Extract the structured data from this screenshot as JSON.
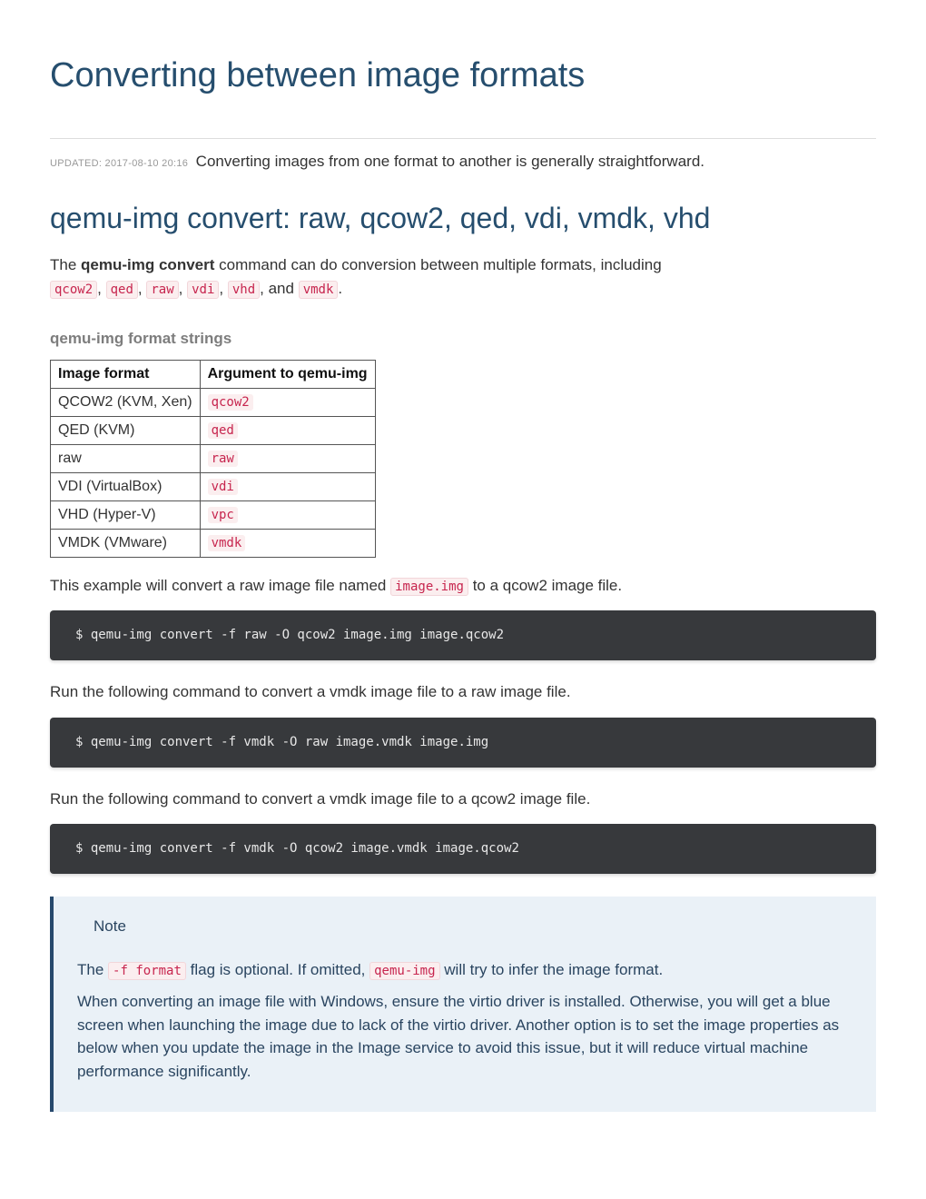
{
  "title": "Converting between image formats",
  "updated_label": "UPDATED: 2017-08-10 20:16",
  "intro": "Converting images from one format to another is generally straightforward.",
  "section_heading": "qemu-img convert: raw, qcow2, qed, vdi, vmdk, vhd",
  "desc_pre": "The ",
  "desc_cmd": "qemu-img convert",
  "desc_mid": " command can do conversion between multiple formats, including ",
  "desc_sep": ", ",
  "desc_and": ", and ",
  "desc_period": ".",
  "format_codes": [
    "qcow2",
    "qed",
    "raw",
    "vdi",
    "vhd",
    "vmdk"
  ],
  "table_title": "qemu-img format strings",
  "table_headers": [
    "Image format",
    "Argument to qemu-img"
  ],
  "table_rows": [
    {
      "format": "QCOW2 (KVM, Xen)",
      "arg": "qcow2"
    },
    {
      "format": "QED (KVM)",
      "arg": "qed"
    },
    {
      "format": "raw",
      "arg": "raw"
    },
    {
      "format": "VDI (VirtualBox)",
      "arg": "vdi"
    },
    {
      "format": "VHD (Hyper-V)",
      "arg": "vpc"
    },
    {
      "format": "VMDK (VMware)",
      "arg": "vmdk"
    }
  ],
  "example_intro_pre": "This example will convert a raw image file named ",
  "example_intro_code": "image.img",
  "example_intro_post": " to a qcow2 image file.",
  "prompt": "$ ",
  "cmd1": "qemu-img convert -f raw -O qcow2 image.img image.qcow2",
  "para2": "Run the following command to convert a vmdk image file to a raw image file.",
  "cmd2": "qemu-img convert -f vmdk -O raw image.vmdk image.img",
  "para3": "Run the following command to convert a vmdk image file to a qcow2 image file.",
  "cmd3": "qemu-img convert -f vmdk -O qcow2 image.vmdk image.qcow2",
  "note_title": "Note",
  "note_p1_pre": "The ",
  "note_p1_code1": "-f format",
  "note_p1_mid": " flag is optional. If omitted, ",
  "note_p1_code2": "qemu-img",
  "note_p1_post": " will try to infer the image format.",
  "note_p2": "When converting an image file with Windows, ensure the virtio driver is installed. Otherwise, you will get a blue screen when launching the image due to lack of the virtio driver. Another option is to set the image properties as below when you update the image in the Image service to avoid this issue, but it will reduce virtual machine performance significantly."
}
